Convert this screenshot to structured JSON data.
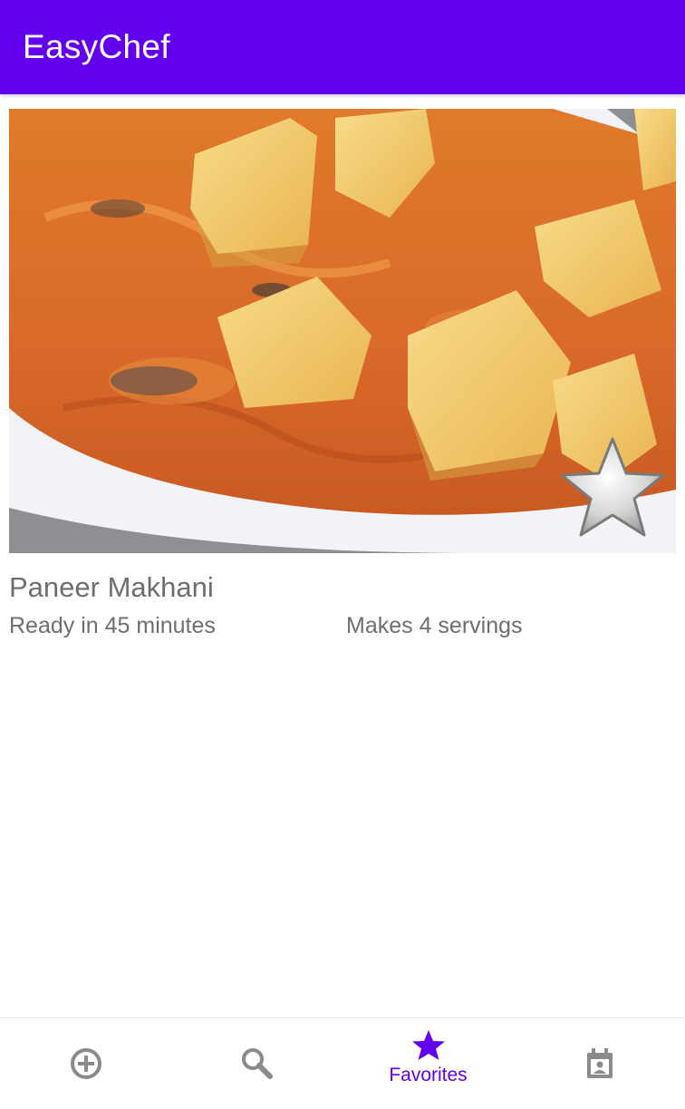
{
  "app_bar": {
    "title": "EasyChef",
    "color": "#6200ee"
  },
  "recipe": {
    "title": "Paneer Makhani",
    "ready_time": "Ready in 45 minutes",
    "servings": "Makes 4 servings",
    "image_icon": "dish-photo",
    "favorite_icon": "star-icon"
  },
  "bottom_nav": {
    "items": [
      {
        "icon": "add-circle-icon",
        "label": "",
        "active": false
      },
      {
        "icon": "search-icon",
        "label": "",
        "active": false
      },
      {
        "icon": "star-icon",
        "label": "Favorites",
        "active": true
      },
      {
        "icon": "calendar-icon",
        "label": "",
        "active": false
      }
    ],
    "active_color": "#6200ee",
    "inactive_color": "#8a8a8a"
  }
}
